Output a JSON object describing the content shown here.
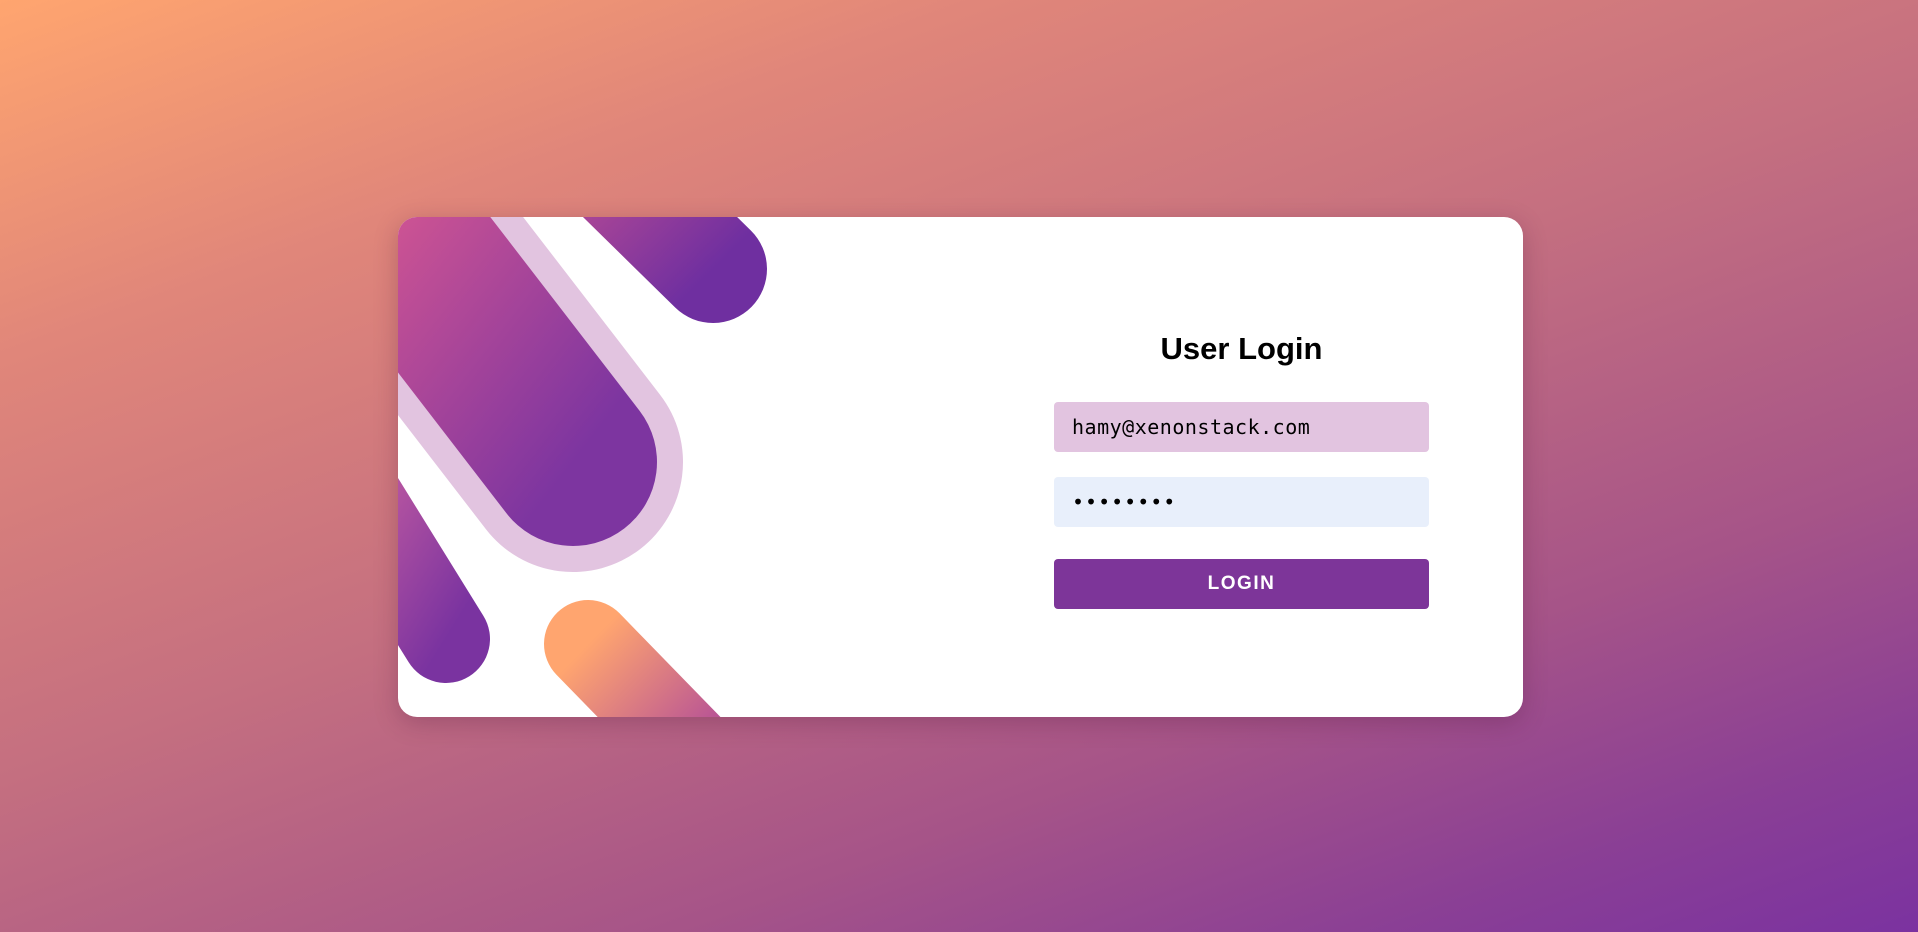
{
  "login": {
    "title": "User Login",
    "email_value": "hamy@xenonstack.com",
    "password_value": "password",
    "button_label": "LOGIN"
  },
  "theme": {
    "accent": "#7d3599",
    "email_field_bg": "#e2c4e0",
    "password_field_bg": "#e8effb",
    "background_start": "#ffa56f",
    "background_end": "#7b32a0"
  }
}
